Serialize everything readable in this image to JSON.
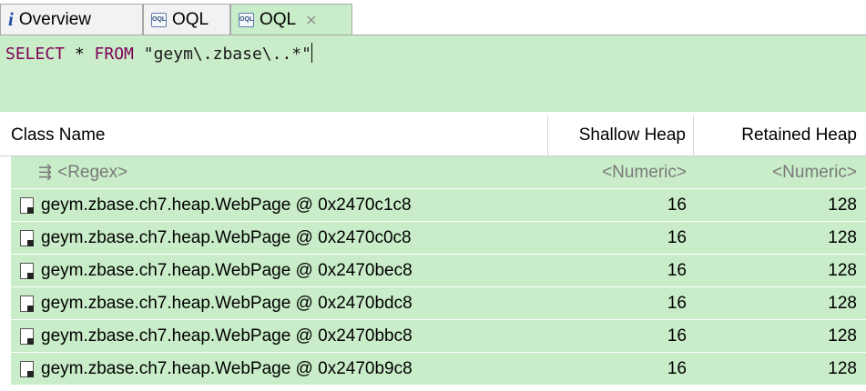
{
  "tabs": [
    {
      "label": "Overview",
      "icon": "info-icon"
    },
    {
      "label": "OQL",
      "icon": "oql-icon"
    },
    {
      "label": "OQL",
      "icon": "oql-icon",
      "active": true,
      "close": "⨯"
    }
  ],
  "editor": {
    "keyword_select": "SELECT",
    "star": " * ",
    "keyword_from": "FROM",
    "literal": " \"geym\\.zbase\\..*\""
  },
  "table": {
    "columns": [
      "Class Name",
      "Shallow Heap",
      "Retained Heap"
    ],
    "filter_row": [
      "<Regex>",
      "<Numeric>",
      "<Numeric>"
    ],
    "rows": [
      {
        "name": "geym.zbase.ch7.heap.WebPage @ 0x2470c1c8",
        "shallow": "16",
        "retained": "128"
      },
      {
        "name": "geym.zbase.ch7.heap.WebPage @ 0x2470c0c8",
        "shallow": "16",
        "retained": "128"
      },
      {
        "name": "geym.zbase.ch7.heap.WebPage @ 0x2470bec8",
        "shallow": "16",
        "retained": "128"
      },
      {
        "name": "geym.zbase.ch7.heap.WebPage @ 0x2470bdc8",
        "shallow": "16",
        "retained": "128"
      },
      {
        "name": "geym.zbase.ch7.heap.WebPage @ 0x2470bbc8",
        "shallow": "16",
        "retained": "128"
      },
      {
        "name": "geym.zbase.ch7.heap.WebPage @ 0x2470b9c8",
        "shallow": "16",
        "retained": "128"
      }
    ]
  },
  "colors": {
    "highlight": "#c9ecc9",
    "keyword": "#7f0055"
  }
}
